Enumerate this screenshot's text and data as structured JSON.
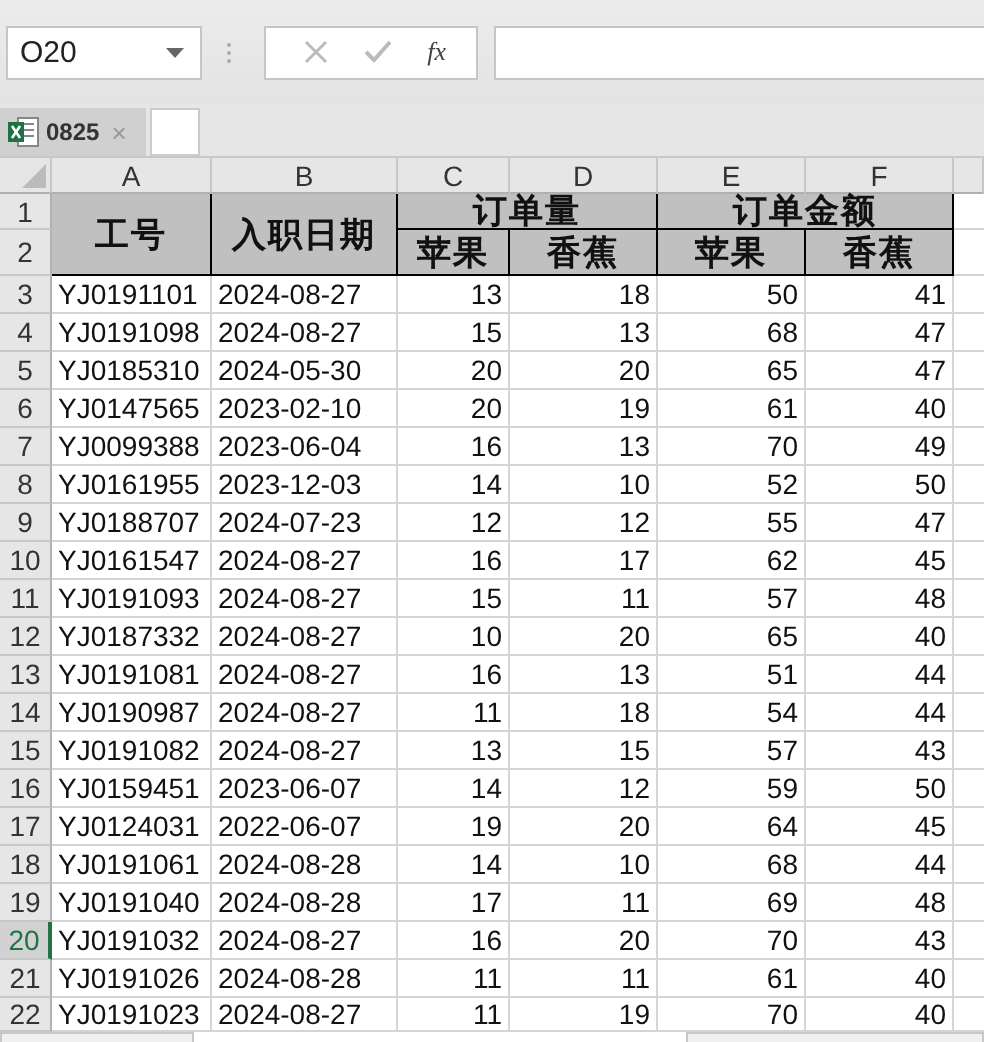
{
  "name_box": {
    "value": "O20"
  },
  "formula_bar": {
    "function_label": "fx"
  },
  "tabs": [
    {
      "label": "0825",
      "close": "×",
      "selected": true
    }
  ],
  "columns": [
    {
      "label": "A",
      "selected": false
    },
    {
      "label": "B",
      "selected": false
    },
    {
      "label": "C",
      "selected": false
    },
    {
      "label": "D",
      "selected": false
    },
    {
      "label": "E",
      "selected": false
    },
    {
      "label": "F",
      "selected": false
    }
  ],
  "header": {
    "row_numbers": [
      "1",
      "2"
    ],
    "id_label": "工号",
    "date_label": "入职日期",
    "groups": [
      {
        "label": "订单量",
        "subs": [
          "苹果",
          "香蕉"
        ]
      },
      {
        "label": "订单金额",
        "subs": [
          "苹果",
          "香蕉"
        ]
      }
    ]
  },
  "rows": [
    {
      "number": "3",
      "selected": false,
      "cells": [
        "YJ0191101",
        "2024-08-27",
        "13",
        "18",
        "50",
        "41"
      ]
    },
    {
      "number": "4",
      "selected": false,
      "cells": [
        "YJ0191098",
        "2024-08-27",
        "15",
        "13",
        "68",
        "47"
      ]
    },
    {
      "number": "5",
      "selected": false,
      "cells": [
        "YJ0185310",
        "2024-05-30",
        "20",
        "20",
        "65",
        "47"
      ]
    },
    {
      "number": "6",
      "selected": false,
      "cells": [
        "YJ0147565",
        "2023-02-10",
        "20",
        "19",
        "61",
        "40"
      ]
    },
    {
      "number": "7",
      "selected": false,
      "cells": [
        "YJ0099388",
        "2023-06-04",
        "16",
        "13",
        "70",
        "49"
      ]
    },
    {
      "number": "8",
      "selected": false,
      "cells": [
        "YJ0161955",
        "2023-12-03",
        "14",
        "10",
        "52",
        "50"
      ]
    },
    {
      "number": "9",
      "selected": false,
      "cells": [
        "YJ0188707",
        "2024-07-23",
        "12",
        "12",
        "55",
        "47"
      ]
    },
    {
      "number": "10",
      "selected": false,
      "cells": [
        "YJ0161547",
        "2024-08-27",
        "16",
        "17",
        "62",
        "45"
      ]
    },
    {
      "number": "11",
      "selected": false,
      "cells": [
        "YJ0191093",
        "2024-08-27",
        "15",
        "11",
        "57",
        "48"
      ]
    },
    {
      "number": "12",
      "selected": false,
      "cells": [
        "YJ0187332",
        "2024-08-27",
        "10",
        "20",
        "65",
        "40"
      ]
    },
    {
      "number": "13",
      "selected": false,
      "cells": [
        "YJ0191081",
        "2024-08-27",
        "16",
        "13",
        "51",
        "44"
      ]
    },
    {
      "number": "14",
      "selected": false,
      "cells": [
        "YJ0190987",
        "2024-08-27",
        "11",
        "18",
        "54",
        "44"
      ]
    },
    {
      "number": "15",
      "selected": false,
      "cells": [
        "YJ0191082",
        "2024-08-27",
        "13",
        "15",
        "57",
        "43"
      ]
    },
    {
      "number": "16",
      "selected": false,
      "cells": [
        "YJ0159451",
        "2023-06-07",
        "14",
        "12",
        "59",
        "50"
      ]
    },
    {
      "number": "17",
      "selected": false,
      "cells": [
        "YJ0124031",
        "2022-06-07",
        "19",
        "20",
        "64",
        "45"
      ]
    },
    {
      "number": "18",
      "selected": false,
      "cells": [
        "YJ0191061",
        "2024-08-28",
        "14",
        "10",
        "68",
        "44"
      ]
    },
    {
      "number": "19",
      "selected": false,
      "cells": [
        "YJ0191040",
        "2024-08-28",
        "17",
        "11",
        "69",
        "48"
      ]
    },
    {
      "number": "20",
      "selected": true,
      "cells": [
        "YJ0191032",
        "2024-08-27",
        "16",
        "20",
        "70",
        "43"
      ]
    },
    {
      "number": "21",
      "selected": false,
      "cells": [
        "YJ0191026",
        "2024-08-28",
        "11",
        "11",
        "61",
        "40"
      ]
    },
    {
      "number": "22",
      "selected": false,
      "cells": [
        "YJ0191023",
        "2024-08-27",
        "11",
        "19",
        "70",
        "40"
      ]
    }
  ]
}
